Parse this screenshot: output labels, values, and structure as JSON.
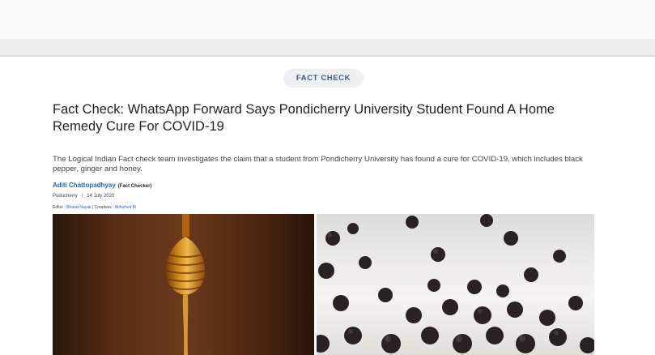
{
  "category": {
    "label": "FACT CHECK"
  },
  "article": {
    "title": "Fact Check: WhatsApp Forward Says Pondicherry University Student Found A Home Remedy Cure For COVID-19",
    "summary": "The Logical Indian Fact check team investigates the claim that a student from Pondicherry University has found a cure for COVID-19, which includes black pepper, ginger and honey.",
    "author": {
      "name": "Aditi Chattopadhyay",
      "role": "(Fact Checker)"
    },
    "location": "Puducherry",
    "separator": "|",
    "date": "14 July 2020",
    "editor_label": "Editor :",
    "editor_name": "Bharat Nayak",
    "credits_separator": "|",
    "creatives_label": "Creatives :",
    "creatives_name": "Abhishek M"
  },
  "images": [
    {
      "subject": "honey-dipper"
    },
    {
      "subject": "black-peppercorns"
    }
  ],
  "colors": {
    "accent": "#1a63c4",
    "pill_bg": "#eef0f2",
    "pill_text": "#3d5a80"
  }
}
